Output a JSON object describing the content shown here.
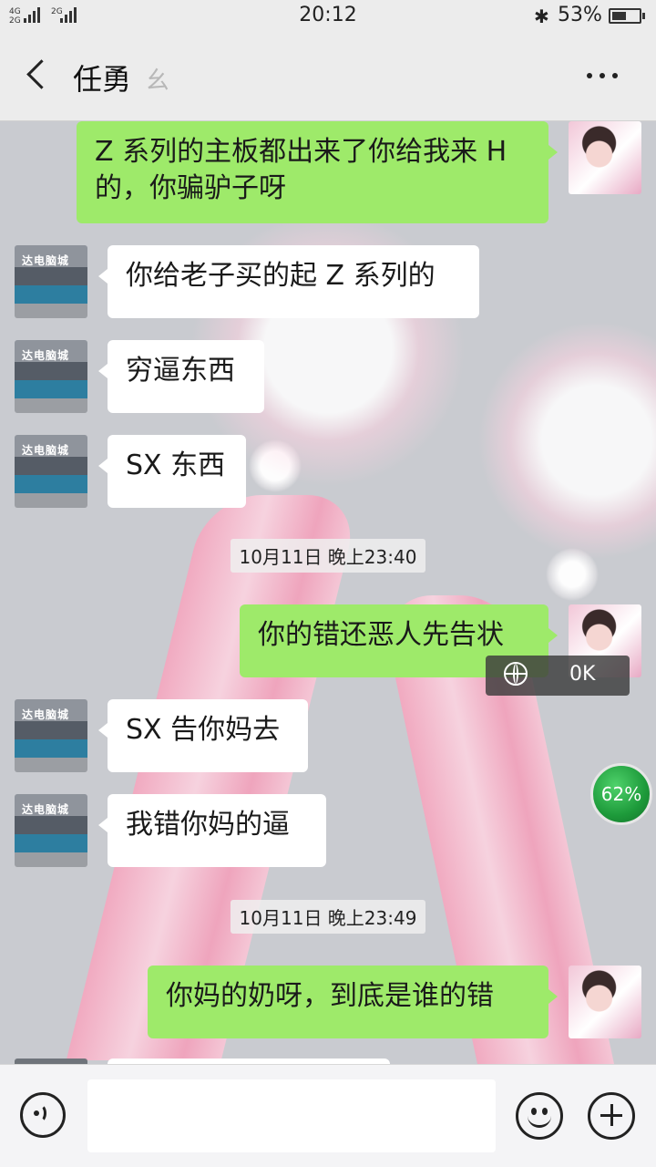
{
  "status_bar": {
    "network_1": "4G",
    "network_2": "2G",
    "network_3": "2G",
    "time": "20:12",
    "bluetooth_icon": "bluetooth-icon",
    "battery_percent": "53%",
    "battery_level": 0.53
  },
  "header": {
    "back_icon": "chevron-left-icon",
    "contact_name": "任勇",
    "earpiece_icon": "ear-icon",
    "more_icon": "more-dots-icon"
  },
  "messages": [
    {
      "from": "me",
      "text": "Z 系列的主板都出来了你给我来 H 的，你骗驴子呀"
    },
    {
      "from": "other",
      "text": "你给老子买的起 Z 系列的"
    },
    {
      "from": "other",
      "text": "穷逼东西"
    },
    {
      "from": "other",
      "text": "SX 东西"
    },
    {
      "from": "me",
      "text": "你的错还恶人先告状"
    },
    {
      "from": "other",
      "text": "SX 告你妈去"
    },
    {
      "from": "other",
      "text": "我错你妈的逼"
    },
    {
      "from": "me",
      "text": "你妈的奶呀，到底是谁的错"
    }
  ],
  "timestamps": [
    "10月11日 晚上23:40",
    "10月11日 晚上23:49"
  ],
  "avatars": {
    "other_sign": "达电脑城"
  },
  "overlays": {
    "net_speed": "0K",
    "memory_percent": "62%"
  },
  "input_bar": {
    "voice_icon": "voice-icon",
    "input_value": "",
    "emoji_icon": "emoji-icon",
    "plus_icon": "plus-icon"
  },
  "colors": {
    "my_bubble": "#9eea6a",
    "their_bubble": "#ffffff",
    "bars_bg": "#ececec"
  }
}
